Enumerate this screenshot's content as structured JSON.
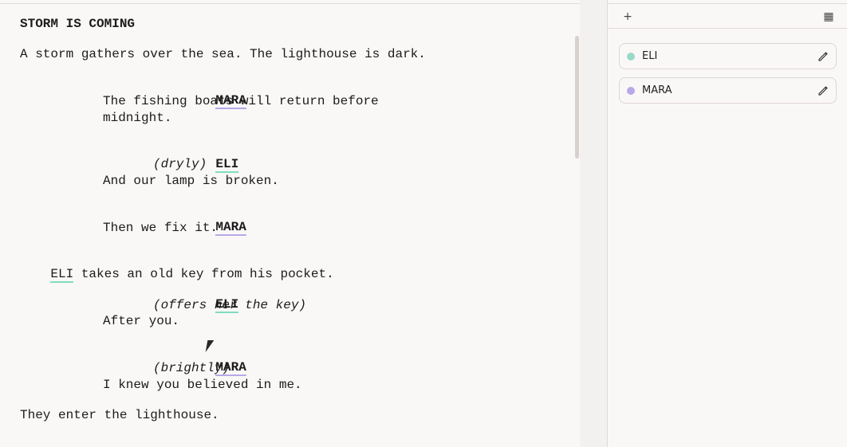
{
  "script": {
    "scene_heading": "STORM IS COMING",
    "lines": [
      {
        "type": "action",
        "text": "A storm gathers over the sea. The lighthouse is dark."
      },
      {
        "type": "character",
        "text": "MARA",
        "speaker": "mara"
      },
      {
        "type": "dialogue",
        "text": "The fishing boats will return before"
      },
      {
        "type": "dialogue",
        "text": "midnight."
      },
      {
        "type": "character",
        "text": "ELI",
        "speaker": "eli"
      },
      {
        "type": "parenthetical",
        "text": "(dryly)"
      },
      {
        "type": "dialogue",
        "text": "And our lamp is broken."
      },
      {
        "type": "character",
        "text": "MARA",
        "speaker": "mara"
      },
      {
        "type": "dialogue",
        "text": "Then we fix it."
      },
      {
        "type": "action_mention",
        "mention": "ELI",
        "text": " takes an old key from his pocket."
      },
      {
        "type": "character",
        "text": "ELI",
        "speaker": "eli"
      },
      {
        "type": "parenthetical",
        "text": "(offers her the key)"
      },
      {
        "type": "dialogue",
        "text": "After you."
      },
      {
        "type": "character",
        "text": "MARA",
        "speaker": "mara"
      },
      {
        "type": "parenthetical",
        "text": "(brightly)"
      },
      {
        "type": "dialogue",
        "text": "I knew you believed in me."
      },
      {
        "type": "action",
        "text": "They enter the lighthouse."
      }
    ]
  },
  "sidebar": {
    "toolbar": {
      "add_icon": "plus-icon",
      "grid_icon": "grid-icon",
      "add_glyph": "+",
      "grid_glyph": "▦"
    },
    "characters": [
      {
        "name": "ELI",
        "color": "#9ad9c8"
      },
      {
        "name": "MARA",
        "color": "#b9a8e8"
      }
    ]
  },
  "colors": {
    "mara": "#b9a8e8",
    "eli": "#7fdcc0",
    "background": "#faf8f7",
    "border": "#e0d8d6"
  }
}
